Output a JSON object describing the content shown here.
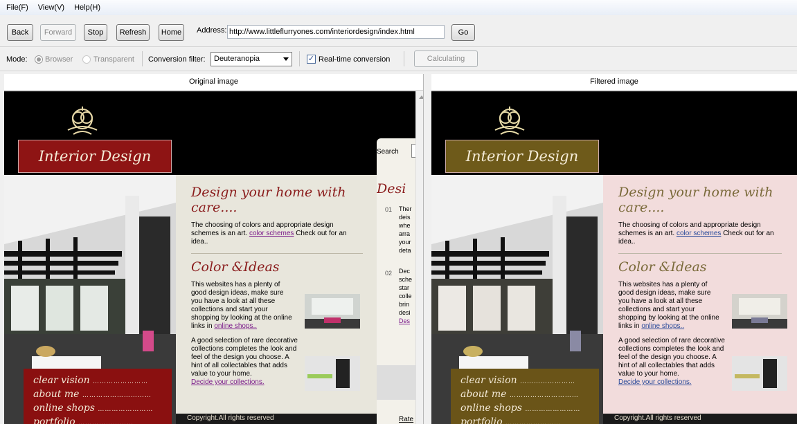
{
  "menu": [
    "File(F)",
    "View(V)",
    "Help(H)"
  ],
  "toolbar": {
    "back": "Back",
    "forward": "Forward",
    "stop": "Stop",
    "refresh": "Refresh",
    "home": "Home",
    "address_label": "Address:",
    "address_value": "http://www.littleflurryones.com/interiordesign/index.html",
    "go": "Go"
  },
  "options": {
    "mode_label": "Mode:",
    "mode_browser": "Browser",
    "mode_transparent": "Transparent",
    "filter_label": "Conversion filter:",
    "filter_value": "Deuteranopia",
    "realtime_label": "Real-time conversion",
    "realtime_checked": true,
    "calculating": "Calculating"
  },
  "panels": {
    "original": "Original image",
    "filtered": "Filtered image"
  },
  "site": {
    "title": "Interior Design",
    "h1": "Design your home with care....",
    "p1_pre": "The choosing of colors and appropriate design schemes is an art.",
    "p1_link": "color schemes",
    "p1_post": "Check out for an idea..",
    "h2": "Color &Ideas",
    "p2_pre": "This websites has a plenty of good design ideas, make sure you have a look at all these collections and start your shopping by looking at the online links in",
    "p2_link": "online shops..",
    "p3": "A good selection of rare decorative collections completes the look and feel of the design you choose. A hint of all collectables that adds value to your home.",
    "p3_link": "Decide your collections.",
    "footer": "Copyright.All rights reserved",
    "nav": [
      "clear vision",
      "about me",
      "online shops",
      "portfolio"
    ],
    "side_search": "Search",
    "side_heading": "Desi",
    "side_items": [
      {
        "num": "01",
        "lines": [
          "Ther",
          "deis",
          "whe",
          "arra",
          "your",
          "deta"
        ]
      },
      {
        "num": "02",
        "lines": [
          "Dec",
          "sche",
          "star",
          "colle",
          "brin",
          "desi",
          "Des"
        ]
      }
    ],
    "side_rate": "Rate"
  },
  "colors": {
    "original": {
      "titlebox": "#8e1414",
      "nav": "#8a1010",
      "content_bg": "#e8e6dc",
      "heading": "#8a1c1c",
      "link": "#7a1a8a"
    },
    "filtered": {
      "titlebox": "#6e5a1a",
      "nav": "#6a5418",
      "content_bg": "#f2dcdc",
      "heading": "#7a6a3a",
      "link": "#2a4a9a"
    }
  }
}
